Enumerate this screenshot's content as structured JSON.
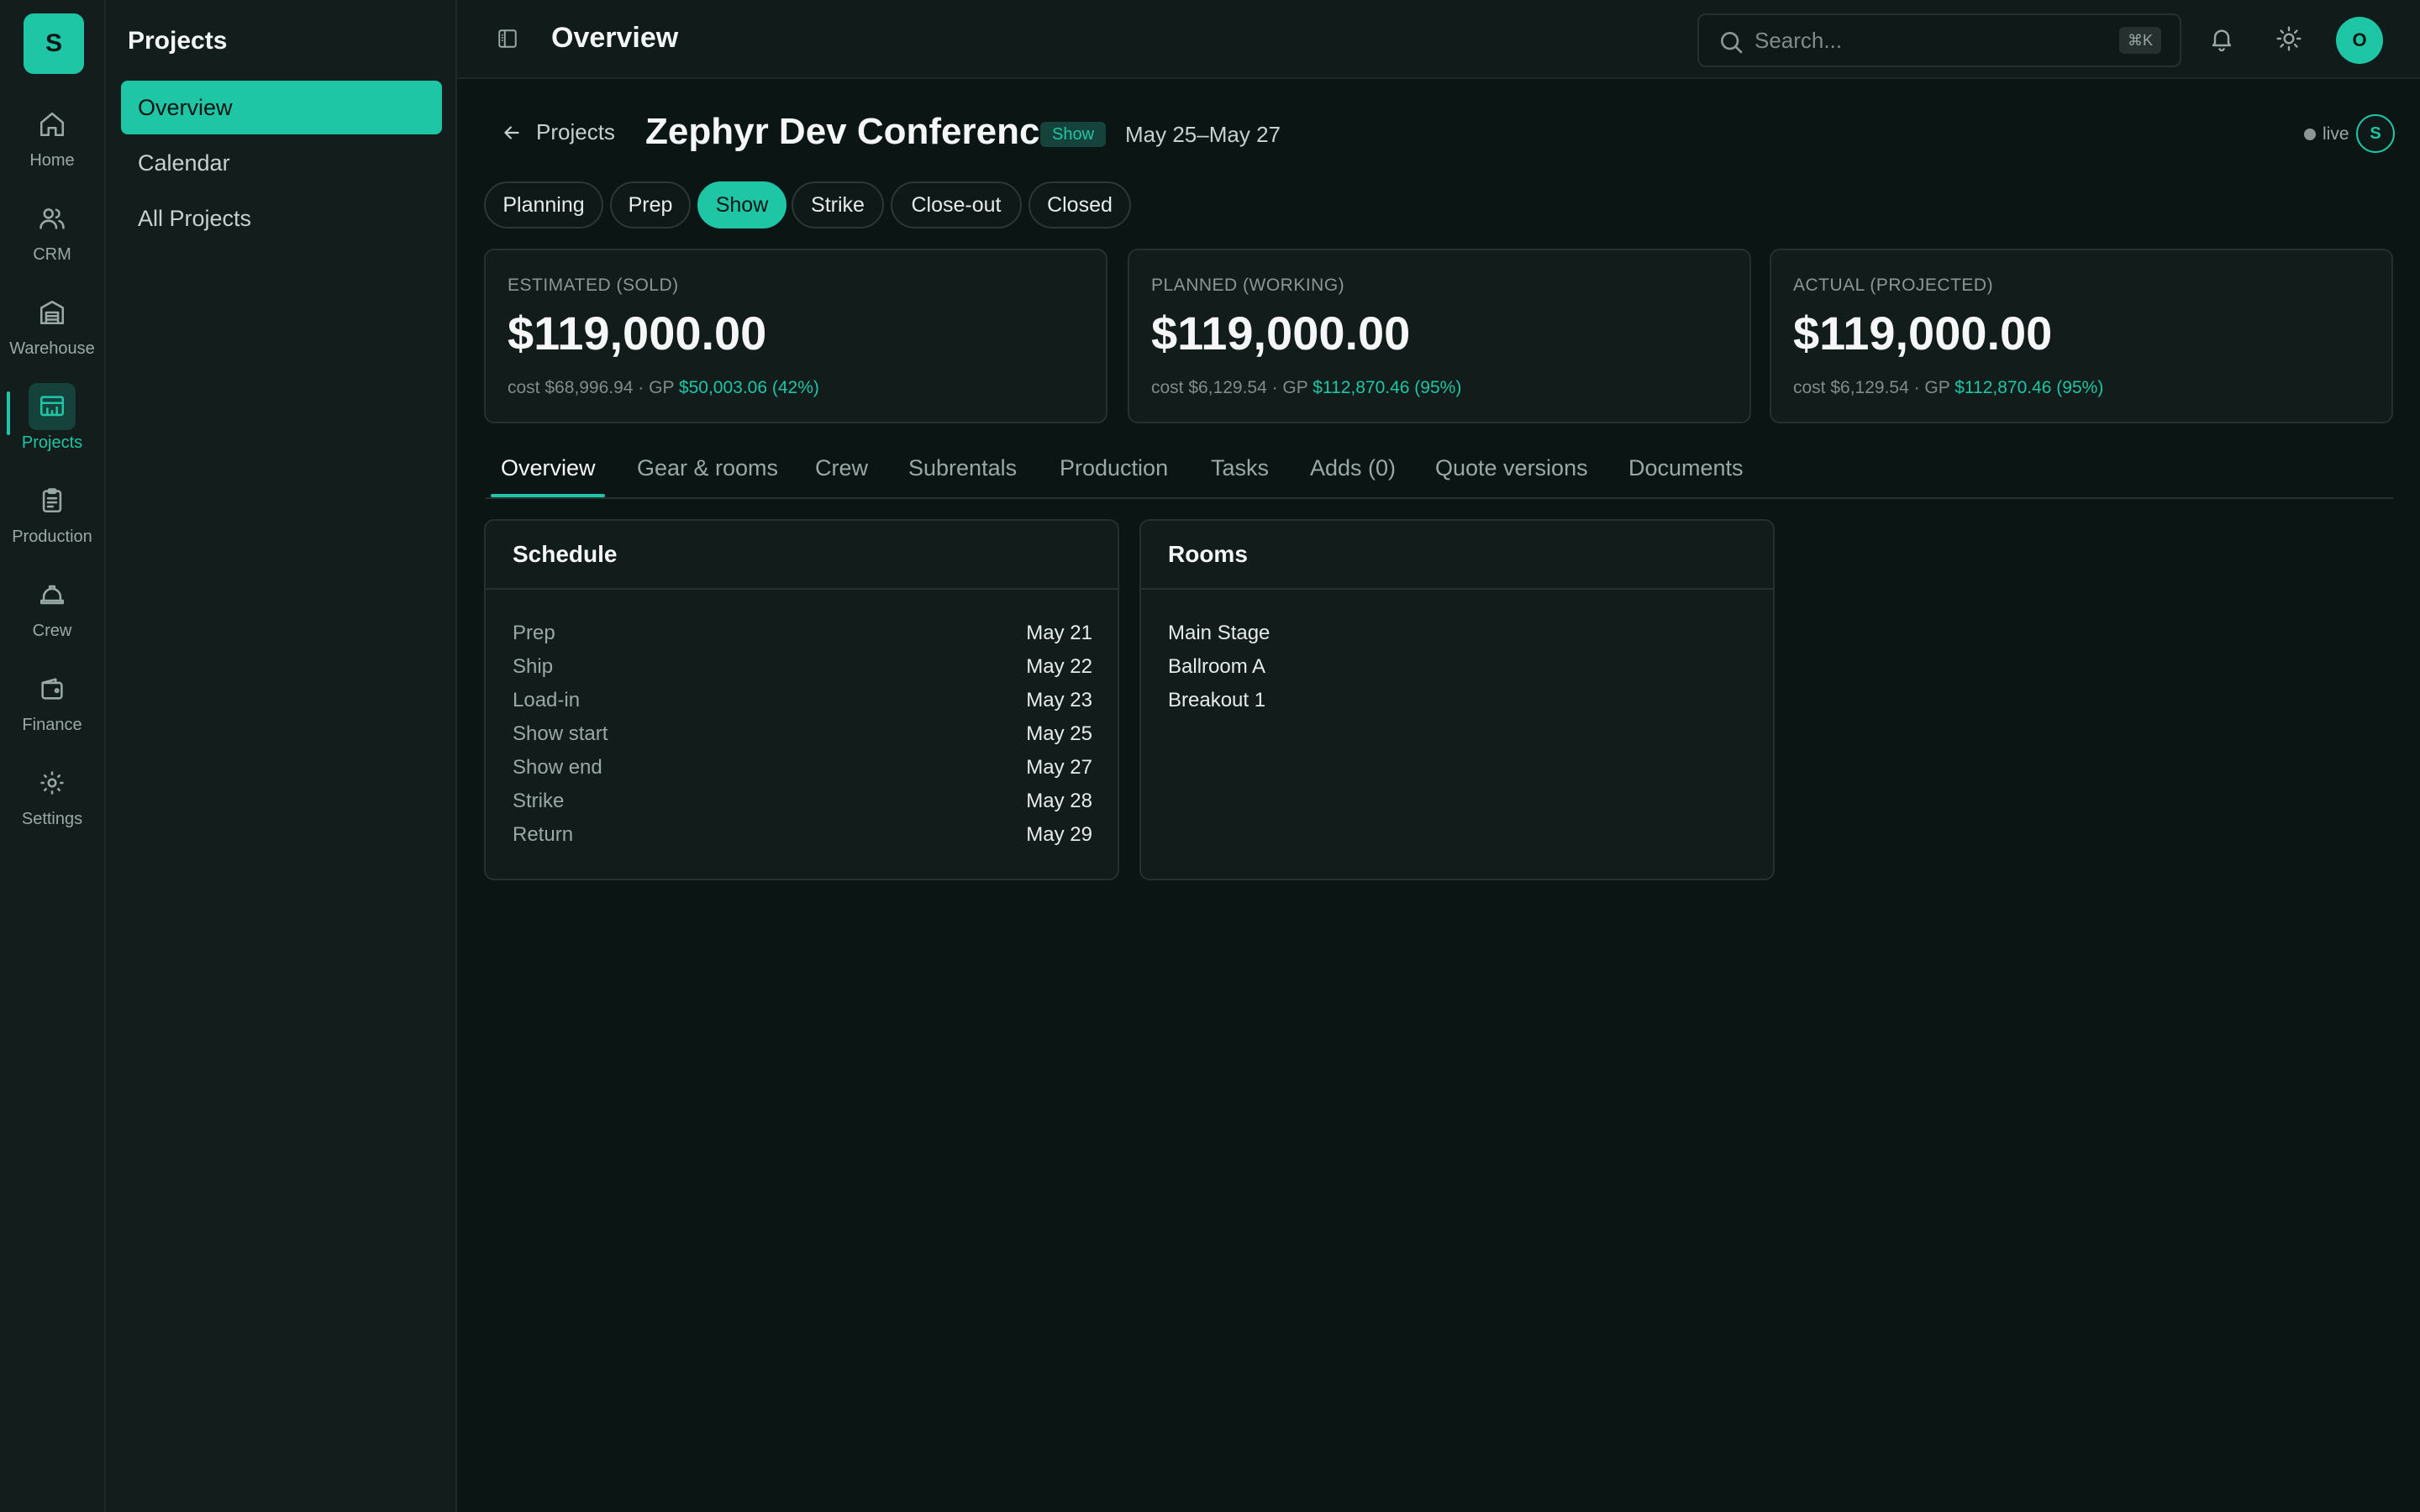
{
  "app": {
    "logo_letter": "S"
  },
  "rail": [
    {
      "id": "home",
      "label": "Home",
      "icon": "home-icon"
    },
    {
      "id": "crm",
      "label": "CRM",
      "icon": "users-icon"
    },
    {
      "id": "warehouse",
      "label": "Warehouse",
      "icon": "warehouse-icon"
    },
    {
      "id": "projects",
      "label": "Projects",
      "icon": "projects-icon",
      "active": true
    },
    {
      "id": "production",
      "label": "Production",
      "icon": "clipboard-icon"
    },
    {
      "id": "crew",
      "label": "Crew",
      "icon": "hardhat-icon"
    },
    {
      "id": "finance",
      "label": "Finance",
      "icon": "wallet-icon"
    },
    {
      "id": "settings",
      "label": "Settings",
      "icon": "gear-icon"
    }
  ],
  "subnav": {
    "title": "Projects",
    "items": [
      {
        "label": "Overview",
        "active": true
      },
      {
        "label": "Calendar"
      },
      {
        "label": "All Projects"
      }
    ]
  },
  "topbar": {
    "title": "Overview",
    "search_placeholder": "Search...",
    "search_shortcut": "⌘K",
    "user_initial": "O"
  },
  "project": {
    "back_label": "Projects",
    "title": "Zephyr Dev Conference",
    "status": "Show",
    "dates": "May 25–May 27",
    "live_label": "live",
    "presence_initial": "S"
  },
  "phases": [
    {
      "label": "Planning"
    },
    {
      "label": "Prep"
    },
    {
      "label": "Show",
      "active": true
    },
    {
      "label": "Strike"
    },
    {
      "label": "Close-out"
    },
    {
      "label": "Closed"
    }
  ],
  "financials": [
    {
      "label": "ESTIMATED (SOLD)",
      "amount": "$119,000.00",
      "cost_text": "cost $68,996.94 · GP ",
      "gp": "$50,003.06 (42%)"
    },
    {
      "label": "PLANNED (WORKING)",
      "amount": "$119,000.00",
      "cost_text": "cost $6,129.54 · GP ",
      "gp": "$112,870.46 (95%)"
    },
    {
      "label": "ACTUAL (PROJECTED)",
      "amount": "$119,000.00",
      "cost_text": "cost $6,129.54 · GP ",
      "gp": "$112,870.46 (95%)"
    }
  ],
  "tabs": [
    {
      "label": "Overview",
      "active": true
    },
    {
      "label": "Gear & rooms"
    },
    {
      "label": "Crew"
    },
    {
      "label": "Subrentals"
    },
    {
      "label": "Production"
    },
    {
      "label": "Tasks"
    },
    {
      "label": "Adds (0)"
    },
    {
      "label": "Quote versions"
    },
    {
      "label": "Documents"
    }
  ],
  "schedule": {
    "title": "Schedule",
    "rows": [
      {
        "label": "Prep",
        "date": "May 21"
      },
      {
        "label": "Ship",
        "date": "May 22"
      },
      {
        "label": "Load-in",
        "date": "May 23"
      },
      {
        "label": "Show start",
        "date": "May 25"
      },
      {
        "label": "Show end",
        "date": "May 27"
      },
      {
        "label": "Strike",
        "date": "May 28"
      },
      {
        "label": "Return",
        "date": "May 29"
      }
    ]
  },
  "rooms": {
    "title": "Rooms",
    "items": [
      "Main Stage",
      "Ballroom A",
      "Breakout 1"
    ]
  },
  "colors": {
    "accent": "#1fc6a5",
    "background": "#0b1514",
    "panel": "#121c1b"
  }
}
